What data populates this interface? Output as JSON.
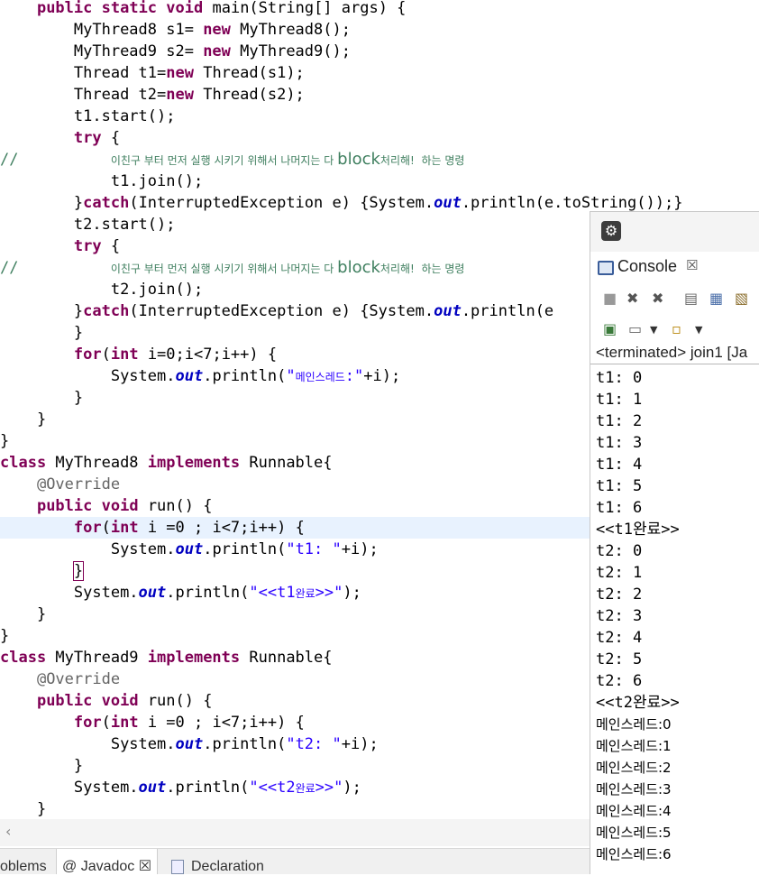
{
  "code": [
    {
      "indent": "    ",
      "tokens": [
        {
          "t": "kw",
          "v": "public"
        },
        {
          "v": " "
        },
        {
          "t": "kw",
          "v": "static"
        },
        {
          "v": " "
        },
        {
          "t": "kw",
          "v": "void"
        },
        {
          "v": " main(String[] args) {"
        }
      ]
    },
    {
      "indent": "        ",
      "tokens": [
        {
          "v": "MyThread8 s1= "
        },
        {
          "t": "kw",
          "v": "new"
        },
        {
          "v": " MyThread8();"
        }
      ]
    },
    {
      "indent": "        ",
      "tokens": [
        {
          "v": "MyThread9 s2= "
        },
        {
          "t": "kw",
          "v": "new"
        },
        {
          "v": " MyThread9();"
        }
      ]
    },
    {
      "indent": "        ",
      "tokens": [
        {
          "v": "Thread t1="
        },
        {
          "t": "kw",
          "v": "new"
        },
        {
          "v": " Thread(s1);"
        }
      ]
    },
    {
      "indent": "        ",
      "tokens": [
        {
          "v": "Thread t2="
        },
        {
          "t": "kw",
          "v": "new"
        },
        {
          "v": " Thread(s2);"
        }
      ]
    },
    {
      "indent": "        ",
      "tokens": [
        {
          "v": "t1.start();"
        }
      ]
    },
    {
      "indent": "        ",
      "tokens": [
        {
          "t": "kw",
          "v": "try"
        },
        {
          "v": " {"
        }
      ]
    },
    {
      "indent": "",
      "tokens": [
        {
          "t": "cmt",
          "v": "//          "
        },
        {
          "t": "krc",
          "v": "이친구 부터 먼저 실행 시키기 위해서 나머지는 다 "
        },
        {
          "t": "krb",
          "v": "block"
        },
        {
          "t": "krc",
          "v": "처리해!  하는 명령"
        }
      ]
    },
    {
      "indent": "            ",
      "tokens": [
        {
          "v": "t1.join();"
        }
      ]
    },
    {
      "indent": "        ",
      "tokens": [
        {
          "v": "}"
        },
        {
          "t": "kw",
          "v": "catch"
        },
        {
          "v": "(InterruptedException e) {System."
        },
        {
          "t": "fld",
          "v": "out"
        },
        {
          "v": ".println(e.toString());}"
        }
      ]
    },
    {
      "indent": "        ",
      "tokens": [
        {
          "v": "t2.start();"
        }
      ]
    },
    {
      "indent": "        ",
      "tokens": [
        {
          "t": "kw",
          "v": "try"
        },
        {
          "v": " {"
        }
      ]
    },
    {
      "indent": "",
      "tokens": [
        {
          "t": "cmt",
          "v": "//          "
        },
        {
          "t": "krc",
          "v": "이친구 부터 먼저 실행 시키기 위해서 나머지는 다 "
        },
        {
          "t": "krb",
          "v": "block"
        },
        {
          "t": "krc",
          "v": "처리해!  하는 명령"
        }
      ]
    },
    {
      "indent": "            ",
      "tokens": [
        {
          "v": "t2.join();"
        }
      ]
    },
    {
      "indent": "        ",
      "tokens": [
        {
          "v": "}"
        },
        {
          "t": "kw",
          "v": "catch"
        },
        {
          "v": "(InterruptedException e) {System."
        },
        {
          "t": "fld",
          "v": "out"
        },
        {
          "v": ".println(e"
        }
      ]
    },
    {
      "indent": "        ",
      "tokens": [
        {
          "v": "}"
        }
      ]
    },
    {
      "indent": "        ",
      "tokens": [
        {
          "t": "kw",
          "v": "for"
        },
        {
          "v": "("
        },
        {
          "t": "kw",
          "v": "int"
        },
        {
          "v": " i=0;i<7;i++) {"
        }
      ]
    },
    {
      "indent": "            ",
      "tokens": [
        {
          "v": "System."
        },
        {
          "t": "fld",
          "v": "out"
        },
        {
          "v": ".println("
        },
        {
          "t": "str",
          "v": "\""
        },
        {
          "t": "str kr",
          "v": "메인스레드"
        },
        {
          "t": "str",
          "v": ":\""
        },
        {
          "v": "+i);"
        }
      ]
    },
    {
      "indent": "        ",
      "tokens": [
        {
          "v": "}"
        }
      ]
    },
    {
      "indent": "    ",
      "tokens": [
        {
          "v": "}"
        }
      ]
    },
    {
      "indent": "",
      "tokens": [
        {
          "v": "}"
        }
      ]
    },
    {
      "indent": "",
      "tokens": [
        {
          "t": "kw",
          "v": "class"
        },
        {
          "v": " MyThread8 "
        },
        {
          "t": "kw",
          "v": "implements"
        },
        {
          "v": " Runnable{"
        }
      ]
    },
    {
      "indent": "    ",
      "tokens": [
        {
          "t": "ann",
          "v": "@Override"
        }
      ]
    },
    {
      "indent": "    ",
      "tokens": [
        {
          "t": "kw",
          "v": "public"
        },
        {
          "v": " "
        },
        {
          "t": "kw",
          "v": "void"
        },
        {
          "v": " run() {"
        }
      ]
    },
    {
      "indent": "        ",
      "hl": true,
      "tokens": [
        {
          "t": "kw",
          "v": "for"
        },
        {
          "v": "("
        },
        {
          "t": "kw",
          "v": "int"
        },
        {
          "v": " i =0 ; i<7;i++) {"
        }
      ]
    },
    {
      "indent": "            ",
      "tokens": [
        {
          "v": "System."
        },
        {
          "t": "fld",
          "v": "out"
        },
        {
          "v": ".println("
        },
        {
          "t": "str",
          "v": "\"t1: \""
        },
        {
          "v": "+i);"
        }
      ]
    },
    {
      "indent": "        ",
      "tokens": [
        {
          "t": "brk",
          "v": "}"
        }
      ]
    },
    {
      "indent": "        ",
      "tokens": [
        {
          "v": "System."
        },
        {
          "t": "fld",
          "v": "out"
        },
        {
          "v": ".println("
        },
        {
          "t": "str",
          "v": "\"<<t1"
        },
        {
          "t": "str kr",
          "v": "완료"
        },
        {
          "t": "str",
          "v": ">>\""
        },
        {
          "v": ");"
        }
      ]
    },
    {
      "indent": "    ",
      "tokens": [
        {
          "v": "}"
        }
      ]
    },
    {
      "indent": "",
      "tokens": [
        {
          "v": "}"
        }
      ]
    },
    {
      "indent": "",
      "tokens": [
        {
          "t": "kw",
          "v": "class"
        },
        {
          "v": " MyThread9 "
        },
        {
          "t": "kw",
          "v": "implements"
        },
        {
          "v": " Runnable{"
        }
      ]
    },
    {
      "indent": "    ",
      "tokens": [
        {
          "t": "ann",
          "v": "@Override"
        }
      ]
    },
    {
      "indent": "    ",
      "tokens": [
        {
          "t": "kw",
          "v": "public"
        },
        {
          "v": " "
        },
        {
          "t": "kw",
          "v": "void"
        },
        {
          "v": " run() {"
        }
      ]
    },
    {
      "indent": "        ",
      "tokens": [
        {
          "t": "kw",
          "v": "for"
        },
        {
          "v": "("
        },
        {
          "t": "kw",
          "v": "int"
        },
        {
          "v": " i =0 ; i<7;i++) {"
        }
      ]
    },
    {
      "indent": "            ",
      "tokens": [
        {
          "v": "System."
        },
        {
          "t": "fld",
          "v": "out"
        },
        {
          "v": ".println("
        },
        {
          "t": "str",
          "v": "\"t2: \""
        },
        {
          "v": "+i);"
        }
      ]
    },
    {
      "indent": "        ",
      "tokens": [
        {
          "v": "}"
        }
      ]
    },
    {
      "indent": "        ",
      "tokens": [
        {
          "v": "System."
        },
        {
          "t": "fld",
          "v": "out"
        },
        {
          "v": ".println("
        },
        {
          "t": "str",
          "v": "\"<<t2"
        },
        {
          "t": "str kr",
          "v": "완료"
        },
        {
          "t": "str",
          "v": ">>\""
        },
        {
          "v": ");"
        }
      ]
    },
    {
      "indent": "    ",
      "tokens": [
        {
          "v": "}"
        }
      ]
    }
  ],
  "bottom_tabs": {
    "problems": "oblems",
    "javadoc": "@ Javadoc ☒",
    "declaration": "Declaration"
  },
  "console": {
    "tab_label": "Console",
    "tab_close": "☒",
    "status": "<terminated> join1 [Ja",
    "output": [
      "t1: 0",
      "t1: 1",
      "t1: 2",
      "t1: 3",
      "t1: 4",
      "t1: 5",
      "t1: 6",
      "<<t1완료>>",
      "t2: 0",
      "t2: 1",
      "t2: 2",
      "t2: 3",
      "t2: 4",
      "t2: 5",
      "t2: 6",
      "<<t2완료>>",
      "메인스레드:0",
      "메인스레드:1",
      "메인스레드:2",
      "메인스레드:3",
      "메인스레드:4",
      "메인스레드:5",
      "메인스레드:6"
    ]
  },
  "colors": {
    "keyword": "#7f0055",
    "field": "#0000c0",
    "string": "#2a00ff",
    "comment": "#3f7f5f",
    "annotation": "#646464",
    "current_line": "#e8f2fe"
  },
  "icons": [
    "eclipse-icon",
    "console-icon",
    "stop-icon",
    "remove-launch-icon",
    "remove-all-icon",
    "clear-console-icon",
    "scroll-lock-icon",
    "word-wrap-icon",
    "pin-console-icon",
    "display-console-icon",
    "open-console-icon",
    "chevron-down-icon"
  ]
}
